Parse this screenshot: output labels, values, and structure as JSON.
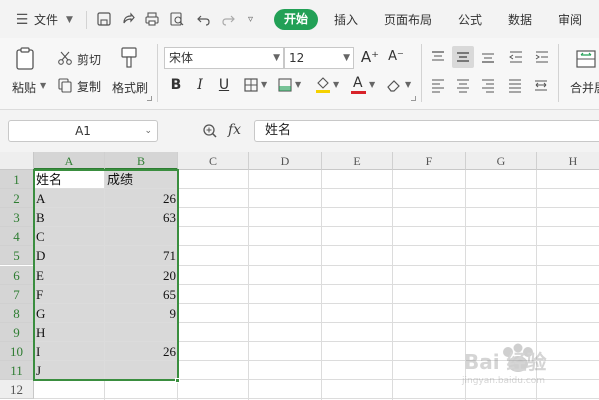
{
  "menubar": {
    "file_label": "文件",
    "tabs": [
      "开始",
      "插入",
      "页面布局",
      "公式",
      "数据",
      "审阅"
    ]
  },
  "ribbon": {
    "paste_label": "粘贴",
    "cut_label": "剪切",
    "copy_label": "复制",
    "format_painter_label": "格式刷",
    "font_name": "宋体",
    "font_size": "12",
    "bold": "B",
    "italic": "I",
    "underline": "U",
    "font_color_glyph": "A",
    "grow_font": "A⁺",
    "shrink_font": "A⁻",
    "merge_label": "合并居"
  },
  "formula_bar": {
    "cell_ref": "A1",
    "fx": "fx",
    "value": "姓名"
  },
  "sheet": {
    "columns": [
      "A",
      "B",
      "C",
      "D",
      "E",
      "F",
      "G",
      "H"
    ],
    "rows": [
      "1",
      "2",
      "3",
      "4",
      "5",
      "6",
      "7",
      "8",
      "9",
      "10",
      "11",
      "12"
    ],
    "cells": [
      [
        "姓名",
        "成绩"
      ],
      [
        "A",
        "26"
      ],
      [
        "B",
        "63"
      ],
      [
        "C",
        ""
      ],
      [
        "D",
        "71"
      ],
      [
        "E",
        "20"
      ],
      [
        "F",
        "65"
      ],
      [
        "G",
        "9"
      ],
      [
        "H",
        ""
      ],
      [
        "I",
        "26"
      ],
      [
        "J",
        ""
      ]
    ]
  },
  "watermark": {
    "text": "Bai 经验",
    "subtext": "jingyan.baidu.com"
  },
  "colors": {
    "accent_green": "#22a056",
    "selection_border": "#3a8e3f"
  }
}
